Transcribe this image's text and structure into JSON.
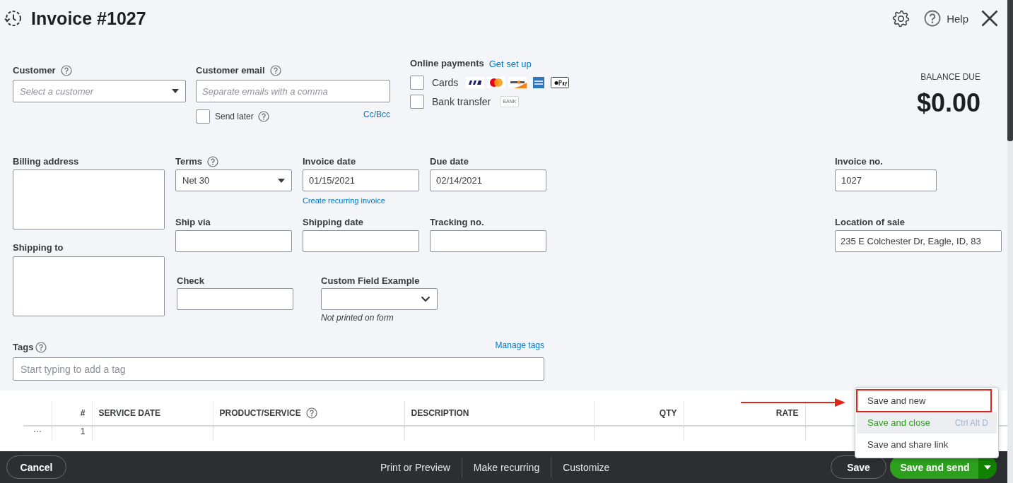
{
  "header": {
    "title": "Invoice #1027",
    "help_label": "Help"
  },
  "customer": {
    "label": "Customer",
    "placeholder": "Select a customer"
  },
  "customer_email": {
    "label": "Customer email",
    "placeholder": "Separate emails with a comma",
    "send_later": {
      "label": "Send later",
      "checked": false
    },
    "cc_bcc": "Cc/Bcc"
  },
  "online_payments": {
    "label": "Online payments",
    "link": "Get set up",
    "methods": [
      {
        "kind": "cards",
        "label": "Cards",
        "checked": false
      },
      {
        "kind": "bank",
        "label": "Bank transfer",
        "checked": false,
        "badge": "BANK"
      }
    ]
  },
  "balance_due": {
    "label": "BALANCE DUE",
    "amount": "$0.00"
  },
  "billing_address": {
    "label": "Billing address"
  },
  "shipping_to": {
    "label": "Shipping to"
  },
  "terms": {
    "label": "Terms",
    "value": "Net 30"
  },
  "invoice_date": {
    "label": "Invoice date",
    "value": "01/15/2021",
    "link": "Create recurring invoice"
  },
  "due_date": {
    "label": "Due date",
    "value": "02/14/2021"
  },
  "invoice_no": {
    "label": "Invoice no.",
    "value": "1027"
  },
  "ship_via": {
    "label": "Ship via"
  },
  "shipping_date": {
    "label": "Shipping date"
  },
  "tracking_no": {
    "label": "Tracking no."
  },
  "location_of_sale": {
    "label": "Location of sale",
    "value": "235 E Colchester Dr, Eagle, ID, 83"
  },
  "check": {
    "label": "Check"
  },
  "custom_field": {
    "label": "Custom Field Example",
    "note": "Not printed on form"
  },
  "tags": {
    "label": "Tags",
    "link": "Manage tags",
    "placeholder": "Start typing to add a tag"
  },
  "table": {
    "columns": [
      {
        "label": "#",
        "kind": "number",
        "help": false
      },
      {
        "label": "SERVICE DATE",
        "kind": "text",
        "help": false
      },
      {
        "label": "PRODUCT/SERVICE",
        "kind": "text",
        "help": true
      },
      {
        "label": "DESCRIPTION",
        "kind": "text",
        "help": false
      },
      {
        "label": "QTY",
        "kind": "number",
        "help": false
      },
      {
        "label": "RATE",
        "kind": "number",
        "help": false
      }
    ],
    "rows": [
      {
        "handle": "⋯",
        "number": "1"
      }
    ]
  },
  "footer": {
    "cancel": "Cancel",
    "links": [
      "Print or Preview",
      "Make recurring",
      "Customize"
    ],
    "save": "Save",
    "save_and_send": "Save and send"
  },
  "save_menu": {
    "items": [
      {
        "label": "Save and new",
        "selected": false,
        "annotated": true
      },
      {
        "label": "Save and close",
        "shortcut": "Ctrl Alt D",
        "selected": true,
        "annotated": false
      },
      {
        "label": "Save and share link",
        "selected": false,
        "annotated": false
      }
    ]
  }
}
